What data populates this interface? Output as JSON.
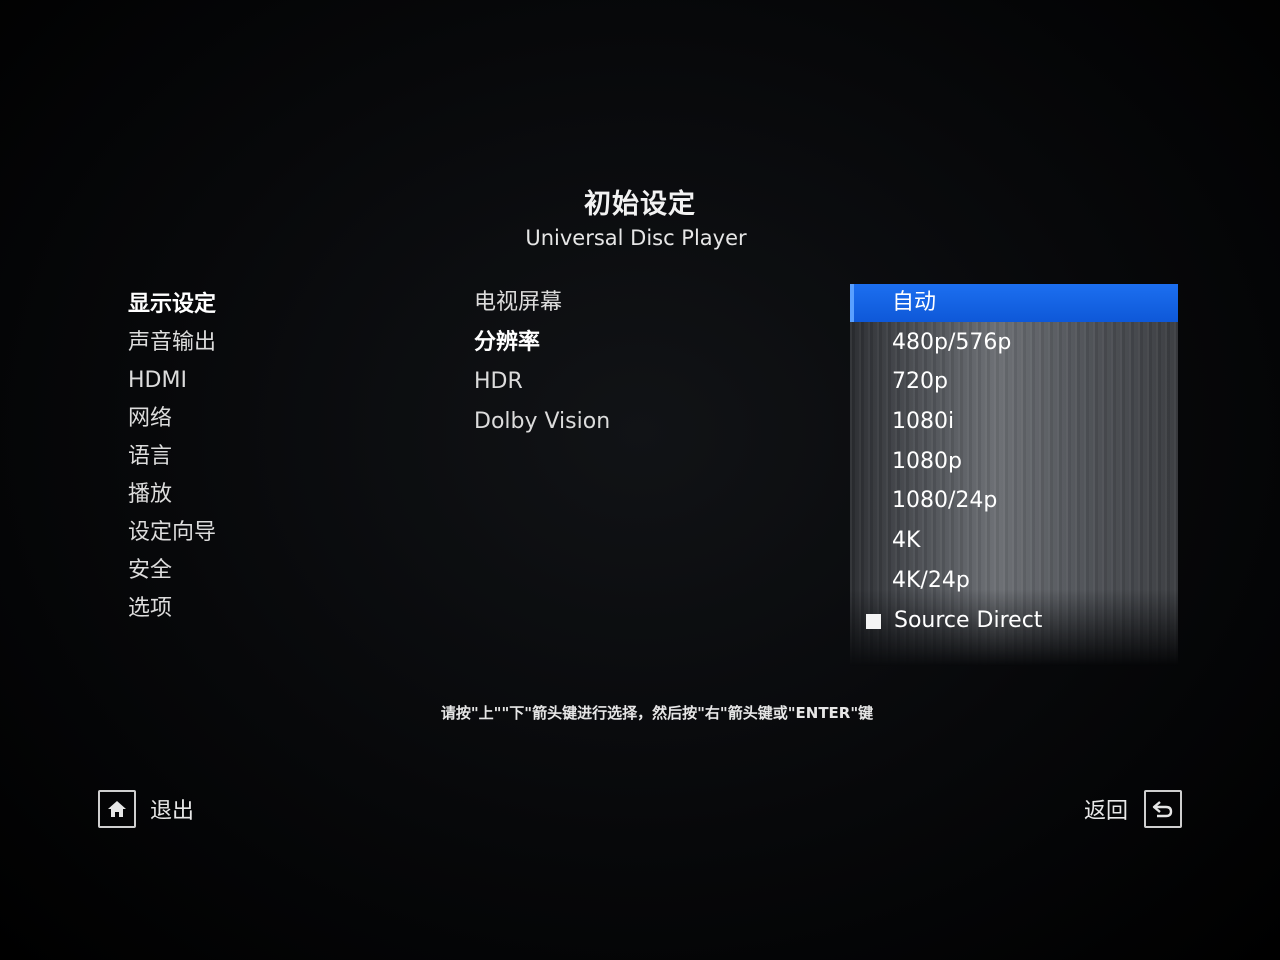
{
  "header": {
    "title": "初始设定",
    "subtitle": "Universal Disc Player"
  },
  "categories": {
    "items": [
      {
        "label": "显示设定",
        "active": true
      },
      {
        "label": "声音输出",
        "active": false
      },
      {
        "label": "HDMI",
        "active": false
      },
      {
        "label": "网络",
        "active": false
      },
      {
        "label": "语言",
        "active": false
      },
      {
        "label": "播放",
        "active": false
      },
      {
        "label": "设定向导",
        "active": false
      },
      {
        "label": "安全",
        "active": false
      },
      {
        "label": "选项",
        "active": false
      }
    ]
  },
  "settings": {
    "items": [
      {
        "label": "电视屏幕",
        "active": false
      },
      {
        "label": "分辨率",
        "active": true
      },
      {
        "label": "HDR",
        "active": false
      },
      {
        "label": "Dolby Vision",
        "active": false
      }
    ]
  },
  "resolution_options": {
    "selected": "自动",
    "items": [
      {
        "label": "自动",
        "selected": true
      },
      {
        "label": "480p/576p",
        "selected": false
      },
      {
        "label": "720p",
        "selected": false
      },
      {
        "label": "1080i",
        "selected": false
      },
      {
        "label": "1080p",
        "selected": false
      },
      {
        "label": "1080/24p",
        "selected": false
      },
      {
        "label": "4K",
        "selected": false
      },
      {
        "label": "4K/24p",
        "selected": false
      },
      {
        "label": "Source Direct",
        "selected": false,
        "checkbox": true
      }
    ]
  },
  "hint": "请按\"上\"\"下\"箭头键进行选择，然后按\"右\"箭头键或\"ENTER\"键",
  "footer": {
    "exit_label": "退出",
    "exit_icon": "home-icon",
    "back_label": "返回",
    "back_icon": "return-icon"
  },
  "colors": {
    "selection": "#1463e8",
    "background": "#000000",
    "text": "#e8e8e8"
  }
}
